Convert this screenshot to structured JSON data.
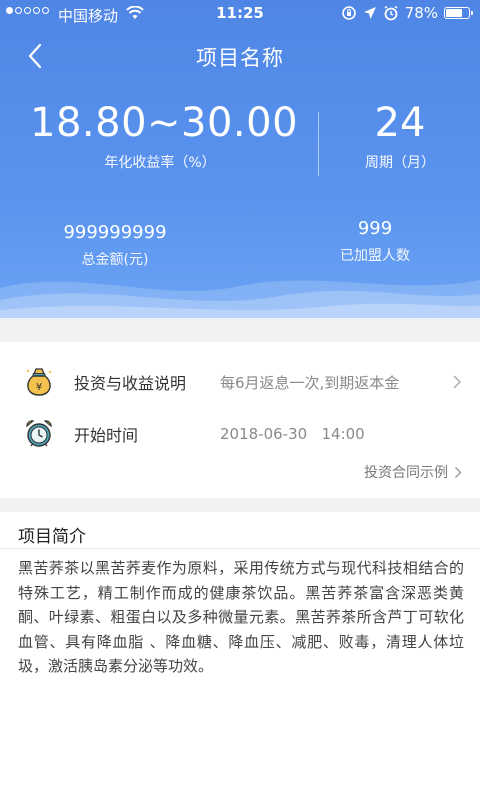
{
  "status_bar": {
    "carrier": "中国移动",
    "time": "11:25",
    "battery": "78%",
    "battery_level": 0.78,
    "signal_bars": 1,
    "icons": [
      "wifi-icon",
      "orientation-lock-icon",
      "location-arrow-icon",
      "alarm-icon",
      "battery-icon"
    ]
  },
  "nav": {
    "title": "项目名称",
    "back_icon": "chevron-left-icon"
  },
  "stats": {
    "rate_value": "18.80~30.00",
    "rate_label": "年化收益率（%）",
    "period_value": "24",
    "period_label": "周期（月）",
    "total_value": "999999999",
    "total_label": "总金额(元)",
    "members_value": "999",
    "members_label": "已加盟人数"
  },
  "info": {
    "invest_label": "投资与收益说明",
    "invest_value": "每6月返息一次,到期返本金",
    "invest_icon": "money-bag-icon",
    "start_label": "开始时间",
    "start_value": "2018-06-30   14:00",
    "start_icon": "alarm-clock-icon",
    "contract_link": "投资合同示例"
  },
  "intro": {
    "title": "项目简介",
    "body": "黑苦荞茶以黑苦荞麦作为原料，采用传统方式与现代科技相结合的特殊工艺，精工制作而成的健康茶饮品。黑苦荞茶富含深恶类黄酮、叶绿素、粗蛋白以及多种微量元素。黑苦荞茶所含芦丁可软化血管、具有降血脂 、降血糖、降血压、减肥、败毒，清理人体垃圾，激活胰岛素分泌等功效。"
  },
  "colors": {
    "hero_top": "#4f86e6",
    "hero_bottom": "#6aa3f4",
    "icon_gold": "#f3c24f",
    "icon_teal": "#4aa6b8"
  }
}
